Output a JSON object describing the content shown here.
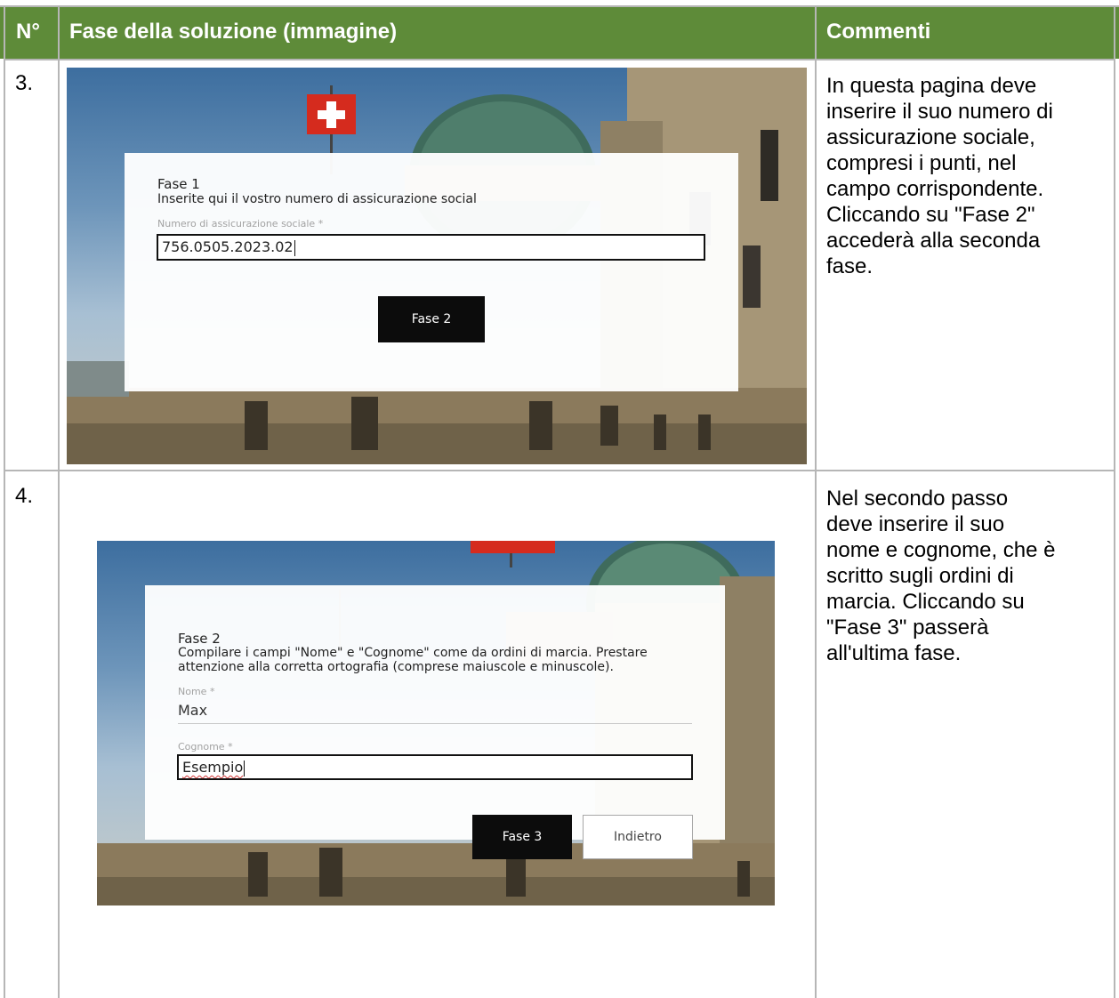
{
  "table": {
    "headers": {
      "number": "N°",
      "step": "Fase della soluzione (immagine)",
      "comments": "Commenti"
    },
    "rows": [
      {
        "number": "3.",
        "comment": "In questa pagina deve\ninserire il suo numero di\nassicurazione sociale,\ncompresi i punti, nel\ncampo corrispondente.\nCliccando su \"Fase 2\"\naccederà alla seconda\nfase."
      },
      {
        "number": "4.",
        "comment": "Nel secondo passo\ndeve inserire il suo\nnome e cognome, che è\nscritto sugli ordini di\nmarcia. Cliccando su\n\"Fase 3\" passerà\nall'ultima fase."
      }
    ]
  },
  "screenshot1": {
    "title": "Fase 1",
    "description": "Inserite qui il vostro numero di assicurazione social",
    "field_label": "Numero di assicurazione sociale *",
    "field_value": "756.0505.2023.02",
    "button": "Fase 2"
  },
  "screenshot2": {
    "title": "Fase 2",
    "description_line1": "Compilare i campi \"Nome\" e \"Cognome\" come da ordini di marcia. Prestare",
    "description_line2": "attenzione alla corretta ortografia (comprese maiuscole e minuscole).",
    "name_label": "Nome *",
    "name_value": "Max",
    "surname_label": "Cognome *",
    "surname_value": "Esempio",
    "primary_button": "Fase 3",
    "secondary_button": "Indietro"
  },
  "colors": {
    "header_bg": "#5e8b39",
    "grid": "#b6b6b6",
    "button_dark": "#0c0c0c"
  }
}
